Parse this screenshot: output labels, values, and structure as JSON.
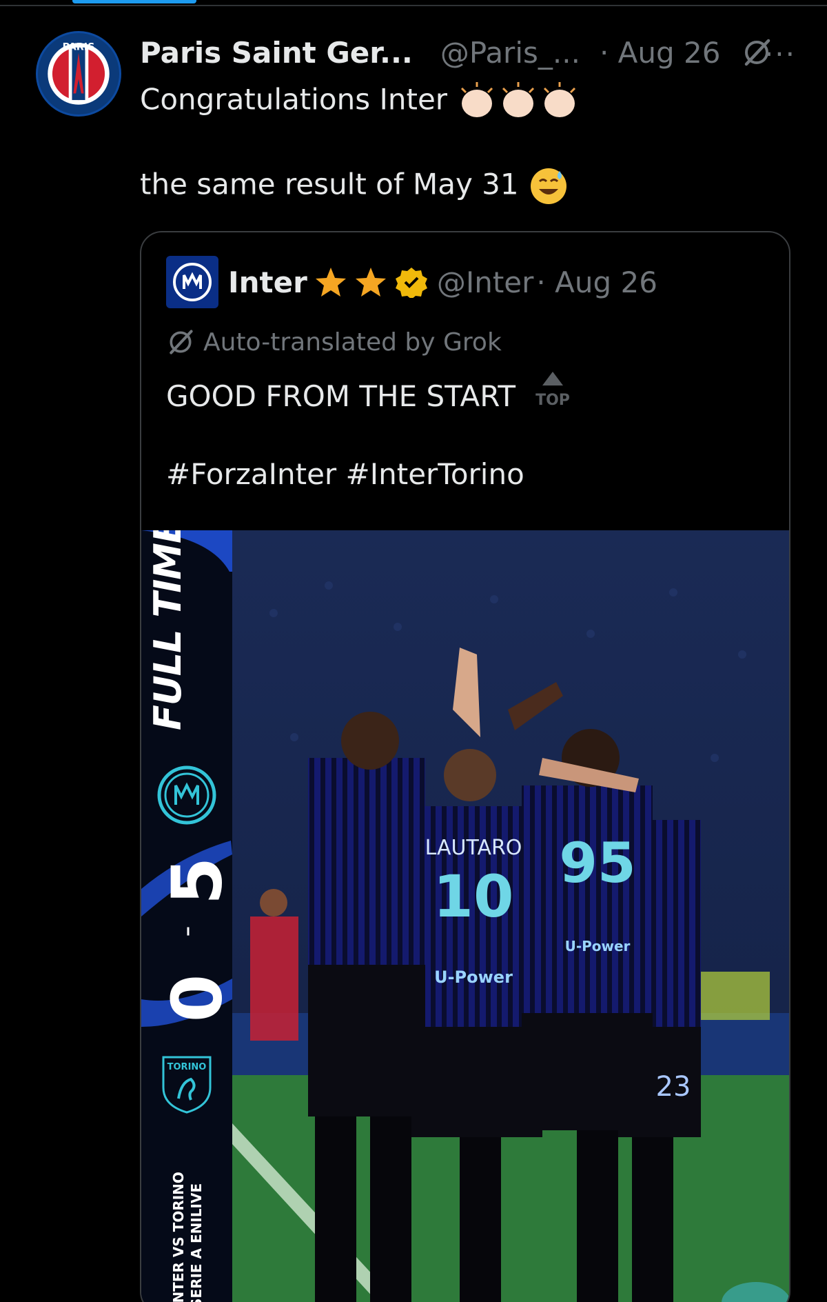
{
  "post": {
    "author_name": "Paris Saint Ger...",
    "author_handle": "@Paris_...",
    "date": "· Aug 26",
    "more": "···",
    "avatar_text": "PARIS",
    "text_line1": "Congratulations Inter",
    "text_line2": "the same result of May 31",
    "colors": {
      "psg_blue": "#0b3a7a",
      "psg_red": "#d21f2f"
    }
  },
  "quote": {
    "name": "Inter",
    "handle": "@Inter",
    "date": "· Aug 26",
    "translated_label": "Auto-translated by Grok",
    "text_line1": "GOOD FROM THE START",
    "top_badge": "TOP",
    "hashtags": "#ForzaInter #InterTorino",
    "colors": {
      "inter_blue": "#0a2e86",
      "star": "#f5a623",
      "verified": "#f0b90b"
    }
  },
  "media": {
    "full_time": "FULL TIME",
    "score_home": "5",
    "score_away": "0",
    "away_badge": "TORINO",
    "match_line1": "INTER VS TORINO",
    "match_line2": "SERIE A ENILIVE",
    "shirt_name": "LAUTARO",
    "shirt_number": "10",
    "shirt_number_2": "95",
    "shirt_number_3": "23",
    "sponsor": "U-Power"
  },
  "icons": [
    "grok-icon",
    "more-icon",
    "clap-icon",
    "sweat-smile-icon",
    "star-icon",
    "verified-badge-icon",
    "top-arrow-icon"
  ]
}
